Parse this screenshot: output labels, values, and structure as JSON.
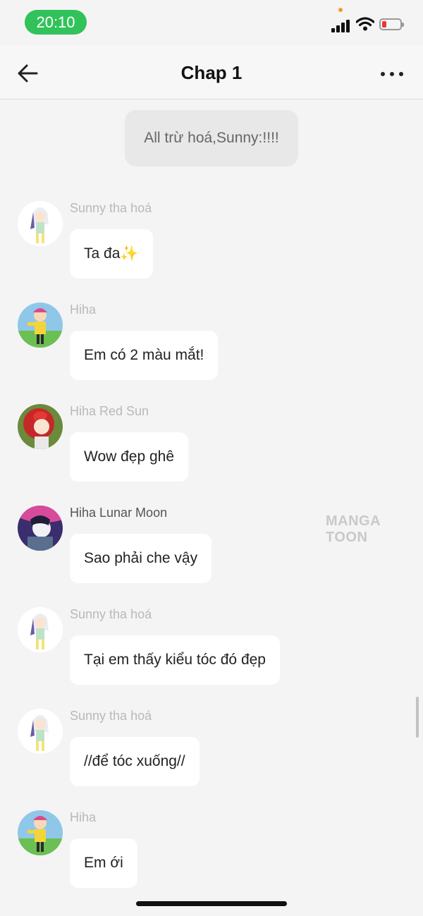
{
  "status_bar": {
    "time": "20:10",
    "icons": [
      "cellular-signal-icon",
      "wifi-icon",
      "battery-low-icon"
    ],
    "battery_color": "#e53935",
    "time_pill_color": "#31c25a"
  },
  "header": {
    "title": "Chap 1",
    "back_icon": "back-arrow-icon",
    "more_icon": "more-dots-icon"
  },
  "narration": "All trừ hoá,Sunny:!!!!",
  "messages": [
    {
      "sender": "Sunny tha hoá",
      "text": "Ta đa",
      "emoji": "✨",
      "avatar": "avatar-sunny"
    },
    {
      "sender": "Hiha",
      "text": "Em có 2 màu mắt!",
      "avatar": "avatar-hiha"
    },
    {
      "sender": "Hiha Red Sun",
      "text": "Wow đẹp ghê",
      "avatar": "avatar-hiha-red-sun"
    },
    {
      "sender": "Hiha Lunar Moon",
      "text": "Sao phải che vậy",
      "avatar": "avatar-hiha-lunar-moon"
    },
    {
      "sender": "Sunny tha hoá",
      "text": "Tại em thấy kiểu tóc đó đẹp",
      "avatar": "avatar-sunny"
    },
    {
      "sender": "Sunny tha hoá",
      "text": "//để tóc xuống//",
      "avatar": "avatar-sunny"
    },
    {
      "sender": "Hiha",
      "text": "Em ới",
      "avatar": "avatar-hiha"
    }
  ],
  "watermark": "MANGA TOON"
}
